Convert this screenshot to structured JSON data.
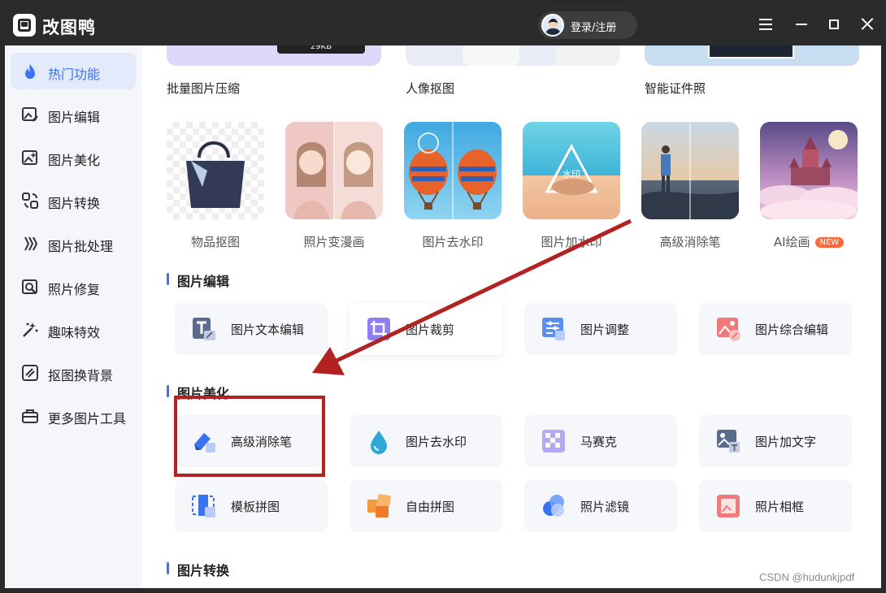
{
  "app": {
    "title": "改图鸭",
    "login_label": "登录/注册"
  },
  "sidebar": {
    "items": [
      {
        "label": "热门功能",
        "icon": "flame-icon",
        "active": true
      },
      {
        "label": "图片编辑",
        "icon": "image-edit-icon"
      },
      {
        "label": "图片美化",
        "icon": "image-beautify-icon"
      },
      {
        "label": "图片转换",
        "icon": "convert-icon"
      },
      {
        "label": "图片批处理",
        "icon": "batch-icon"
      },
      {
        "label": "照片修复",
        "icon": "photo-repair-icon"
      },
      {
        "label": "趣味特效",
        "icon": "magic-wand-icon"
      },
      {
        "label": "抠图换背景",
        "icon": "cutout-icon"
      },
      {
        "label": "更多图片工具",
        "icon": "toolbox-icon"
      }
    ]
  },
  "top_features": [
    {
      "label": "批量图片压缩",
      "thumb_text": "29KB"
    },
    {
      "label": "人像抠图"
    },
    {
      "label": "智能证件照"
    }
  ],
  "hot_features": [
    {
      "label": "物品抠图"
    },
    {
      "label": "照片变漫画"
    },
    {
      "label": "图片去水印"
    },
    {
      "label": "图片加水印",
      "thumb_text": "水印"
    },
    {
      "label": "高级消除笔"
    },
    {
      "label": "AI绘画",
      "badge": "NEW"
    }
  ],
  "sections": {
    "edit": {
      "title": "图片编辑",
      "tools": [
        {
          "label": "图片文本编辑",
          "icon": "text-edit-icon"
        },
        {
          "label": "图片裁剪",
          "icon": "crop-icon"
        },
        {
          "label": "图片调整",
          "icon": "adjust-icon"
        },
        {
          "label": "图片综合编辑",
          "icon": "composite-edit-icon"
        }
      ]
    },
    "beautify": {
      "title": "图片美化",
      "tools": [
        {
          "label": "高级消除笔",
          "icon": "eraser-icon"
        },
        {
          "label": "图片去水印",
          "icon": "water-drop-icon"
        },
        {
          "label": "马赛克",
          "icon": "mosaic-icon"
        },
        {
          "label": "图片加文字",
          "icon": "add-text-icon"
        },
        {
          "label": "模板拼图",
          "icon": "template-collage-icon"
        },
        {
          "label": "自由拼图",
          "icon": "free-collage-icon"
        },
        {
          "label": "照片滤镜",
          "icon": "filter-icon"
        },
        {
          "label": "照片相框",
          "icon": "frame-icon"
        }
      ]
    },
    "convert": {
      "title": "图片转换"
    }
  },
  "watermark": "CSDN @hudunkjpdf",
  "colors": {
    "accent": "#3b72f0",
    "annotation": "#b32222",
    "titlebar": "#2b2b2b"
  }
}
